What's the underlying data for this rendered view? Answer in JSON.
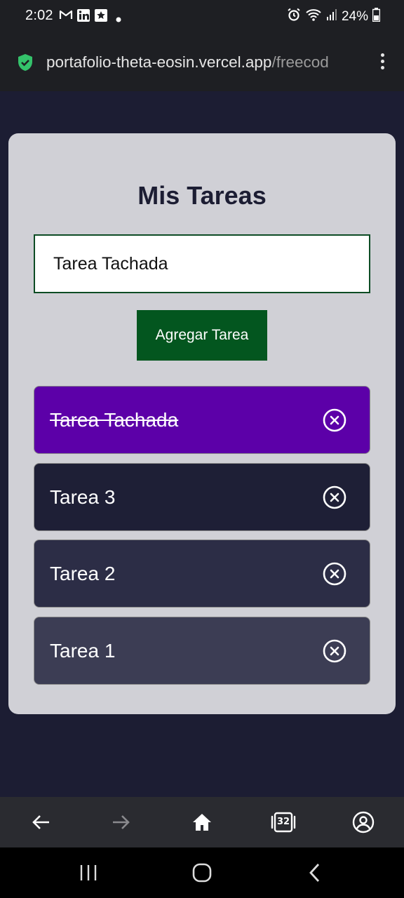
{
  "status_bar": {
    "time": "2:02",
    "battery": "24%",
    "notification_icons": [
      "gmail-icon",
      "linkedin-icon",
      "star-app-icon",
      "dot-icon"
    ],
    "system_icons": [
      "alarm-icon",
      "wifi-icon",
      "signal-icon",
      "battery-icon"
    ]
  },
  "browser": {
    "url_host": "portafolio-theta-eosin.vercel.app",
    "url_path": "/freecod",
    "secure_icon": "shield-check-icon",
    "shield_color": "#34c26b",
    "toolbar_icons": [
      "back-arrow-icon",
      "forward-arrow-icon",
      "home-icon",
      "tabs-icon",
      "account-icon"
    ],
    "tab_count": "32"
  },
  "app": {
    "title": "Mis Tareas",
    "input_value": "Tarea Tachada",
    "add_button_label": "Agregar Tarea",
    "tasks": [
      {
        "label": "Tarea Tachada",
        "completed": true,
        "bg": "#5c00a8"
      },
      {
        "label": "Tarea 3",
        "completed": false,
        "bg": "#1e1f36"
      },
      {
        "label": "Tarea 2",
        "completed": false,
        "bg": "#2c2d46"
      },
      {
        "label": "Tarea 1",
        "completed": false,
        "bg": "#3c3d54"
      }
    ],
    "delete_icon": "close-circle-icon",
    "colors": {
      "page_bg": "#1c1d33",
      "card_bg": "#d0d0d6",
      "button_bg": "#03561f"
    }
  },
  "nav_bar": {
    "icons": [
      "recent-apps-icon",
      "home-circle-icon",
      "back-chevron-icon"
    ]
  }
}
